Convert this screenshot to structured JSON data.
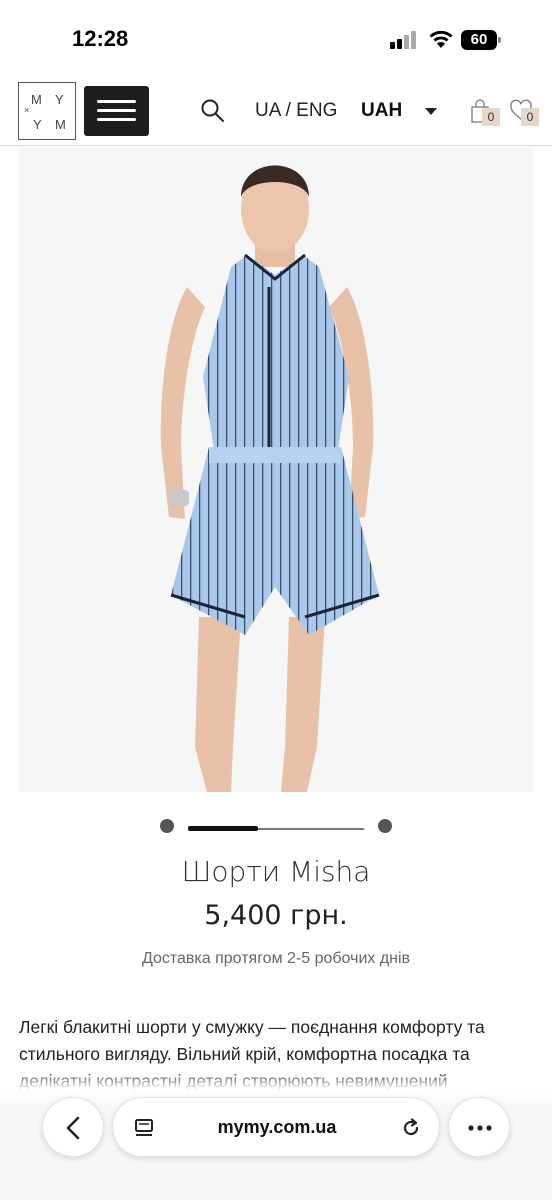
{
  "status_bar": {
    "time": "12:28",
    "battery": "60"
  },
  "header": {
    "logo_letters": [
      "M",
      "Y",
      "Y",
      "M"
    ],
    "logo_small": "×",
    "lang_switch": "UA / ENG",
    "currency": "UAH",
    "cart_count": "0",
    "wishlist_count": "0"
  },
  "gallery": {
    "progress": 0.4
  },
  "product": {
    "title": "Шорти Misha",
    "price": "5,400 грн.",
    "delivery": "Доставка протягом 2-5 робочих днів",
    "description": "Легкі блакитні шорти у смужку — поєднання комфорту та стильного вигляду. Вільний крій, комфортна посадка та делікатні контрастні деталі створюють невимушений"
  },
  "browser": {
    "url": "mymy.com.ua"
  },
  "colors": {
    "accent_dark": "#1d1d1d",
    "badge_bg": "#e7d7c8",
    "garment_blue": "#a9c8ea"
  }
}
